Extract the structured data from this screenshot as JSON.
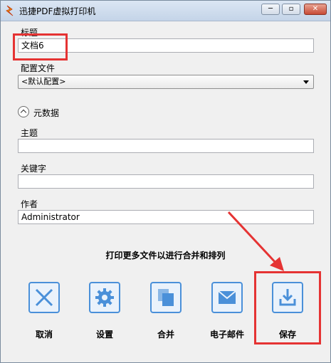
{
  "window": {
    "title": "迅捷PDF虚拟打印机",
    "min_glyph": "─",
    "max_glyph": "▫",
    "close_glyph": "✕"
  },
  "form": {
    "title_label": "标题",
    "title_value": "文档6",
    "profile_label": "配置文件",
    "profile_value": "<默认配置>",
    "metadata_label": "元数据",
    "subject_label": "主题",
    "subject_value": "",
    "keywords_label": "关键字",
    "keywords_value": "",
    "author_label": "作者",
    "author_value": "Administrator"
  },
  "hint": "打印更多文件以进行合并和排列",
  "actions": {
    "cancel": "取消",
    "settings": "设置",
    "merge": "合并",
    "email": "电子邮件",
    "save": "保存"
  },
  "colors": {
    "accent": "#4a90d9",
    "annotation_red": "#e53333"
  }
}
